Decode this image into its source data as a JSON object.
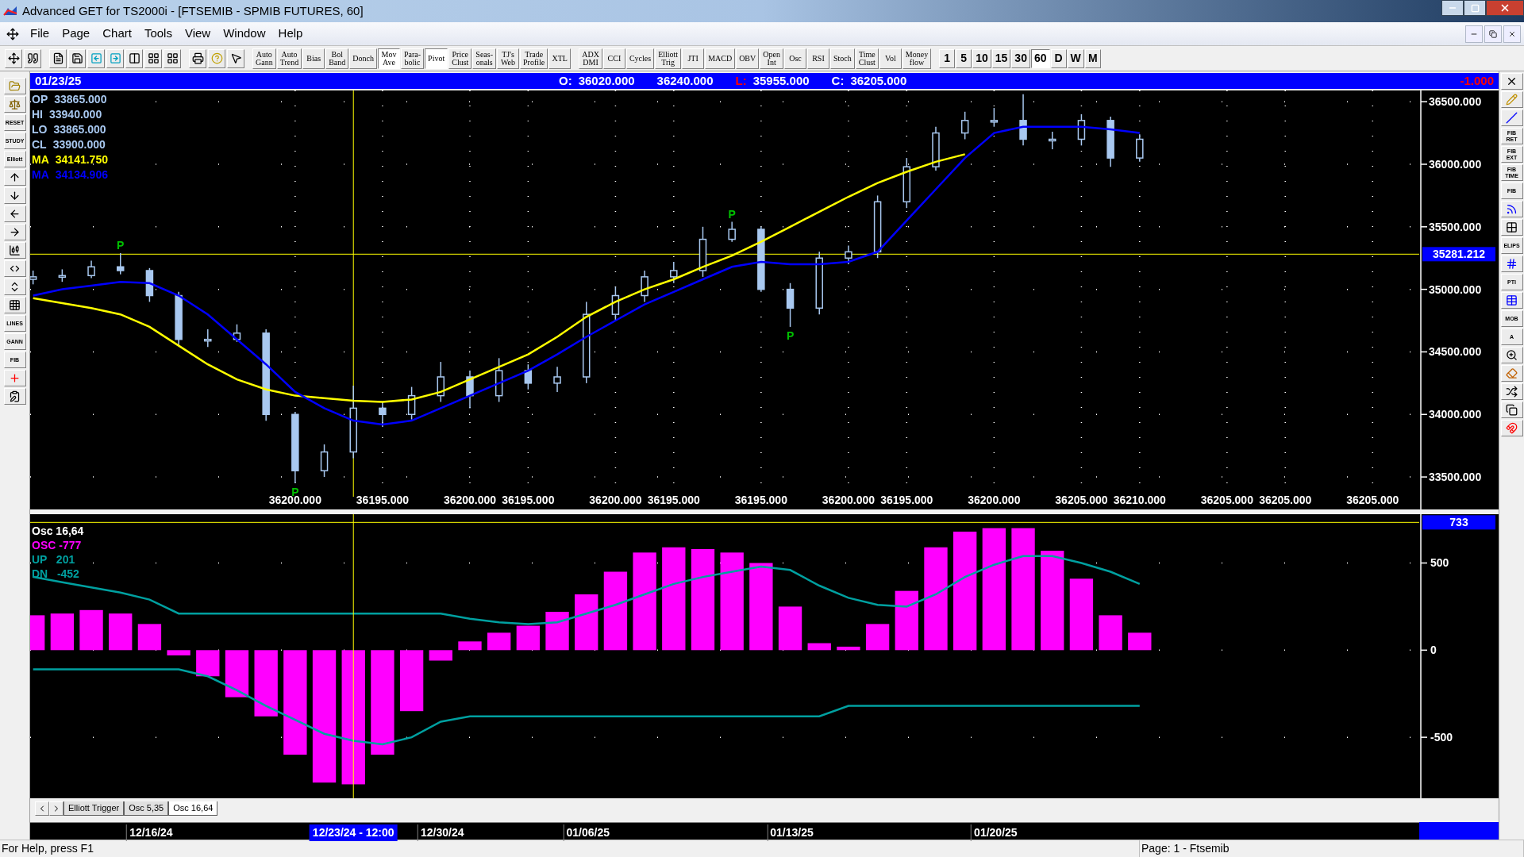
{
  "window": {
    "title": "Advanced GET for TS2000i - [FTSEMIB - SPMIB FUTURES, 60]"
  },
  "menu": [
    "File",
    "Page",
    "Chart",
    "Tools",
    "View",
    "Window",
    "Help"
  ],
  "toolbar": {
    "studies": [
      {
        "label": "Auto\nGann",
        "pressed": false
      },
      {
        "label": "Auto\nTrend",
        "pressed": false
      },
      {
        "label": "Bias",
        "pressed": false
      },
      {
        "label": "Bol\nBand",
        "pressed": false
      },
      {
        "label": "Donch",
        "pressed": false
      },
      {
        "label": "Mov\nAve",
        "pressed": true
      },
      {
        "label": "Para-\nbolic",
        "pressed": false
      },
      {
        "label": "Pivot",
        "pressed": true
      },
      {
        "label": "Price\nClust",
        "pressed": false
      },
      {
        "label": "Seas-\nonals",
        "pressed": false
      },
      {
        "label": "TJ's\nWeb",
        "pressed": false
      },
      {
        "label": "Trade\nProfile",
        "pressed": false
      },
      {
        "label": "XTL",
        "pressed": false
      }
    ],
    "oscillators": [
      {
        "label": "ADX\nDMI",
        "pressed": false
      },
      {
        "label": "CCI",
        "pressed": false
      },
      {
        "label": "Cycles",
        "pressed": false
      },
      {
        "label": "Elliott\nTrig",
        "pressed": false
      },
      {
        "label": "JTI",
        "pressed": false
      },
      {
        "label": "MACD",
        "pressed": false
      },
      {
        "label": "OBV",
        "pressed": false
      },
      {
        "label": "Open\nInt",
        "pressed": false
      },
      {
        "label": "Osc",
        "pressed": false
      },
      {
        "label": "RSI",
        "pressed": false
      },
      {
        "label": "Stoch",
        "pressed": false
      },
      {
        "label": "Time\nClust",
        "pressed": false
      },
      {
        "label": "Vol",
        "pressed": false
      },
      {
        "label": "Money\nflow",
        "pressed": false
      }
    ],
    "timeframes": [
      {
        "label": "1",
        "selected": false
      },
      {
        "label": "5",
        "selected": false
      },
      {
        "label": "10",
        "selected": false
      },
      {
        "label": "15",
        "selected": false
      },
      {
        "label": "30",
        "selected": false
      },
      {
        "label": "60",
        "selected": true
      },
      {
        "label": "D",
        "selected": false
      },
      {
        "label": "W",
        "selected": false
      },
      {
        "label": "M",
        "selected": false
      }
    ]
  },
  "left_toolbar": [
    {
      "kind": "icon"
    },
    {
      "kind": "icon"
    },
    {
      "kind": "label",
      "label": "RESET"
    },
    {
      "kind": "label",
      "label": "STUDY"
    },
    {
      "kind": "label",
      "label": "Elliott"
    },
    {
      "kind": "icon"
    },
    {
      "kind": "icon"
    },
    {
      "kind": "icon"
    },
    {
      "kind": "icon"
    },
    {
      "kind": "icon"
    },
    {
      "kind": "icon"
    },
    {
      "kind": "icon"
    },
    {
      "kind": "icon"
    },
    {
      "kind": "label",
      "label": "LINES"
    },
    {
      "kind": "label",
      "label": "GANN"
    },
    {
      "kind": "label",
      "label": "FIB"
    },
    {
      "kind": "icon"
    },
    {
      "kind": "icon"
    }
  ],
  "right_toolbar": [
    {
      "kind": "icon"
    },
    {
      "kind": "icon"
    },
    {
      "kind": "icon"
    },
    {
      "kind": "label",
      "label": "FIB\nRET"
    },
    {
      "kind": "label",
      "label": "FIB\nEXT"
    },
    {
      "kind": "label",
      "label": "FIB\nTIME"
    },
    {
      "kind": "label",
      "label": "FIB"
    },
    {
      "kind": "icon"
    },
    {
      "kind": "icon"
    },
    {
      "kind": "label",
      "label": "ELIPS"
    },
    {
      "kind": "icon"
    },
    {
      "kind": "label",
      "label": "PTI"
    },
    {
      "kind": "icon"
    },
    {
      "kind": "label",
      "label": "MOB"
    },
    {
      "kind": "label",
      "label": "A"
    },
    {
      "kind": "icon"
    },
    {
      "kind": "icon"
    },
    {
      "kind": "icon"
    },
    {
      "kind": "icon"
    },
    {
      "kind": "icon"
    }
  ],
  "info_bar": {
    "date": "01/23/25",
    "fields": [
      {
        "label": "O:",
        "color": "#ffffff",
        "value": "36020.000"
      },
      {
        "value": "36240.000"
      },
      {
        "label": "L:",
        "color": "#ff0000",
        "value": "35955.000"
      },
      {
        "label": "C:",
        "color": "#ffffff",
        "value": "36205.000"
      }
    ],
    "change": "-1.000"
  },
  "price_pane": {
    "legend": [
      {
        "label": "OP",
        "value": "33865.000",
        "color": "#a8c8f0"
      },
      {
        "label": "HI",
        "value": "33940.000",
        "color": "#a8c8f0"
      },
      {
        "label": "LO",
        "value": "33865.000",
        "color": "#a8c8f0"
      },
      {
        "label": "CL",
        "value": "33900.000",
        "color": "#a8c8f0"
      },
      {
        "label": "MA",
        "value": "34141.750",
        "color": "#ffff00"
      },
      {
        "label": "MA",
        "value": "34134.906",
        "color": "#0000ff"
      }
    ],
    "chart_data": {
      "type": "candlestick",
      "categories": [
        null,
        null,
        null,
        null,
        null,
        null,
        null,
        null,
        null,
        "36200.000",
        null,
        null,
        "36195.000",
        null,
        null,
        "36200.000",
        null,
        "36195.000",
        null,
        null,
        "36200.000",
        null,
        "36195.000",
        null,
        null,
        "36195.000",
        null,
        null,
        "36200.000",
        null,
        "36195.000",
        null,
        null,
        "36200.000",
        null,
        null,
        "36205.000",
        null,
        "36210.000",
        null,
        null,
        "36205.000",
        null,
        "36205.000",
        null,
        null,
        "36205.000",
        null
      ],
      "ohlc": [
        [
          35080,
          35150,
          35040,
          35100
        ],
        [
          35100,
          35160,
          35060,
          35110
        ],
        [
          35110,
          35230,
          35090,
          35180
        ],
        [
          35180,
          35290,
          35120,
          35150
        ],
        [
          35150,
          35170,
          34900,
          34950
        ],
        [
          34950,
          34980,
          34550,
          34600
        ],
        [
          34600,
          34680,
          34540,
          34600
        ],
        [
          34600,
          34720,
          34580,
          34650
        ],
        [
          34650,
          34680,
          33950,
          34000
        ],
        [
          34000,
          34020,
          33450,
          33550
        ],
        [
          33550,
          33760,
          33500,
          33700
        ],
        [
          33700,
          34230,
          33650,
          34050
        ],
        [
          34050,
          34100,
          33900,
          34000
        ],
        [
          34000,
          34220,
          33960,
          34150
        ],
        [
          34150,
          34420,
          34100,
          34300
        ],
        [
          34300,
          34350,
          34050,
          34150
        ],
        [
          34150,
          34450,
          34100,
          34350
        ],
        [
          34350,
          34400,
          34200,
          34250
        ],
        [
          34250,
          34380,
          34180,
          34300
        ],
        [
          34300,
          34900,
          34250,
          34800
        ],
        [
          34800,
          35020,
          34750,
          34950
        ],
        [
          34950,
          35150,
          34900,
          35100
        ],
        [
          35100,
          35220,
          35050,
          35150
        ],
        [
          35150,
          35500,
          35100,
          35400
        ],
        [
          35400,
          35540,
          35380,
          35480
        ],
        [
          35480,
          35500,
          34980,
          35000
        ],
        [
          35000,
          35050,
          34700,
          34850
        ],
        [
          34850,
          35300,
          34800,
          35250
        ],
        [
          35250,
          35350,
          35200,
          35300
        ],
        [
          35300,
          35750,
          35250,
          35700
        ],
        [
          35700,
          36050,
          35650,
          35980
        ],
        [
          35980,
          36300,
          35950,
          36250
        ],
        [
          36250,
          36420,
          36200,
          36350
        ],
        [
          36350,
          36450,
          36300,
          36350
        ],
        [
          36350,
          36560,
          36150,
          36200
        ],
        [
          36200,
          36260,
          36120,
          36200
        ],
        [
          36200,
          36400,
          36150,
          36350
        ],
        [
          36350,
          36380,
          35980,
          36050
        ],
        [
          36050,
          36240,
          36020,
          36200
        ],
        null,
        null,
        null,
        null,
        null,
        null,
        null,
        null,
        null
      ],
      "ylim": [
        33380,
        36590
      ],
      "grid": true,
      "series": [
        {
          "type": "line",
          "color": "#ffff00",
          "values": [
            34930,
            34890,
            34850,
            34800,
            34700,
            34550,
            34400,
            34280,
            34200,
            34150,
            34130,
            34110,
            34100,
            34120,
            34180,
            34280,
            34380,
            34480,
            34620,
            34780,
            34900,
            35000,
            35080,
            35180,
            35270,
            35380,
            35500,
            35620,
            35740,
            35850,
            35940,
            36020,
            36080,
            null,
            null,
            null,
            null,
            null,
            null,
            null,
            null,
            null,
            null,
            null,
            null,
            null,
            null,
            null
          ]
        },
        {
          "type": "line",
          "color": "#0000ff",
          "values": [
            34950,
            35000,
            35030,
            35060,
            35050,
            34950,
            34800,
            34600,
            34400,
            34180,
            34050,
            33950,
            33920,
            33950,
            34050,
            34150,
            34250,
            34350,
            34480,
            34620,
            34750,
            34880,
            34980,
            35080,
            35180,
            35220,
            35200,
            35200,
            35220,
            35300,
            35550,
            35800,
            36050,
            36250,
            36300,
            36300,
            36300,
            36280,
            36250,
            null,
            null,
            null,
            null,
            null,
            null,
            null,
            null,
            null
          ]
        }
      ],
      "yticks": [
        {
          "value": 33500,
          "label": "33500.000"
        },
        {
          "value": 34000,
          "label": "34000.000"
        },
        {
          "value": 34500,
          "label": "34500.000"
        },
        {
          "value": 35000,
          "label": "35000.000"
        },
        {
          "value": 35500,
          "label": "35500.000"
        },
        {
          "value": 36000,
          "label": "36000.000"
        },
        {
          "value": 36500,
          "label": "36500.000"
        }
      ],
      "annotations": [
        {
          "text": "P",
          "y": 35290
        },
        {
          "text": "P",
          "y": 33450
        },
        {
          "text": "P",
          "y": 35540
        },
        {
          "text": "P",
          "y": 34700
        }
      ],
      "ref_lines": [
        {
          "axis": "y",
          "value": 35281.212,
          "label": "35281.212"
        }
      ]
    }
  },
  "osc_pane": {
    "legend": [
      {
        "label": "Osc 16,64",
        "color": "#ffffff"
      },
      {
        "label": "OSC -777",
        "color": "#ff00ff"
      },
      {
        "label": "UP   201",
        "color": "#00a0a0"
      },
      {
        "label": "DN   -452",
        "color": "#00a0a0"
      }
    ],
    "chart_data": {
      "type": "bar",
      "categories": [
        null,
        null,
        null,
        null,
        "12/16/24",
        null,
        null,
        null,
        null,
        null,
        null,
        "12/23/24 - 12:00",
        null,
        null,
        "12/30/24",
        null,
        null,
        null,
        null,
        "01/06/25",
        null,
        null,
        null,
        null,
        null,
        null,
        "01/13/25",
        null,
        null,
        null,
        null,
        null,
        null,
        "01/20/25",
        null,
        null,
        null,
        null,
        null,
        null,
        null,
        null,
        null,
        null,
        null,
        null,
        null,
        null
      ],
      "ylim": [
        -850,
        780
      ],
      "grid": true,
      "series": [
        {
          "color": "#ff00ff",
          "values": [
            200,
            210,
            230,
            210,
            150,
            -30,
            -150,
            -270,
            -380,
            -600,
            -760,
            -770,
            -600,
            -350,
            -60,
            50,
            100,
            140,
            220,
            320,
            450,
            560,
            590,
            580,
            560,
            500,
            250,
            40,
            20,
            150,
            340,
            590,
            680,
            700,
            700,
            570,
            410,
            200,
            100,
            null,
            null,
            null,
            null,
            null,
            null,
            null,
            null,
            null
          ]
        },
        {
          "type": "line",
          "color": "#00a0a0",
          "values": [
            420,
            390,
            360,
            330,
            290,
            210,
            210,
            210,
            210,
            210,
            210,
            210,
            210,
            210,
            210,
            180,
            160,
            150,
            160,
            210,
            260,
            320,
            380,
            420,
            450,
            480,
            460,
            370,
            300,
            260,
            250,
            320,
            420,
            490,
            540,
            540,
            500,
            450,
            380,
            null,
            null,
            null,
            null,
            null,
            null,
            null,
            null,
            null
          ]
        },
        {
          "type": "line",
          "color": "#00a0a0",
          "values": [
            -110,
            -110,
            -110,
            -110,
            -110,
            -110,
            -150,
            -230,
            -320,
            -400,
            -480,
            -520,
            -540,
            -500,
            -410,
            -380,
            -380,
            -380,
            -380,
            -380,
            -380,
            -380,
            -380,
            -380,
            -380,
            -380,
            -380,
            -380,
            -320,
            -320,
            -320,
            -320,
            -320,
            -320,
            -320,
            -320,
            -320,
            -320,
            -320,
            null,
            null,
            null,
            null,
            null,
            null,
            null,
            null,
            null
          ]
        }
      ],
      "yticks": [
        {
          "value": 500,
          "label": "500"
        },
        {
          "value": 0,
          "label": "0"
        },
        {
          "value": -500,
          "label": "-500"
        }
      ],
      "ref_lines": [
        {
          "axis": "y",
          "value": 733,
          "label": "733"
        },
        {
          "axis": "x",
          "value": "12/23/24 - 12:00"
        }
      ]
    },
    "tabs": [
      {
        "label": "Elliott Trigger",
        "selected": false
      },
      {
        "label": "Osc 5,35",
        "selected": false
      },
      {
        "label": "Osc 16,64",
        "selected": true
      }
    ]
  },
  "status_bar": {
    "help": "For Help, press F1",
    "page": "Page: 1 - Ftsemib"
  }
}
